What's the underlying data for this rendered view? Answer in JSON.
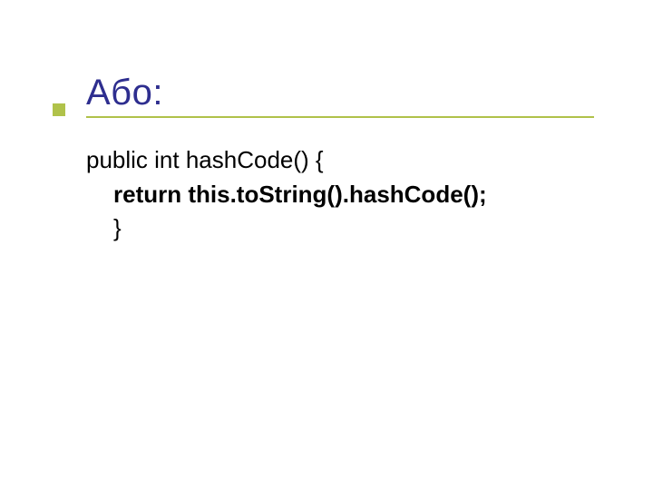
{
  "slide": {
    "title": "Або:",
    "code": {
      "line1": "public int hashCode() {",
      "line2": "return this.toString().hashCode();",
      "line3": "}"
    }
  }
}
